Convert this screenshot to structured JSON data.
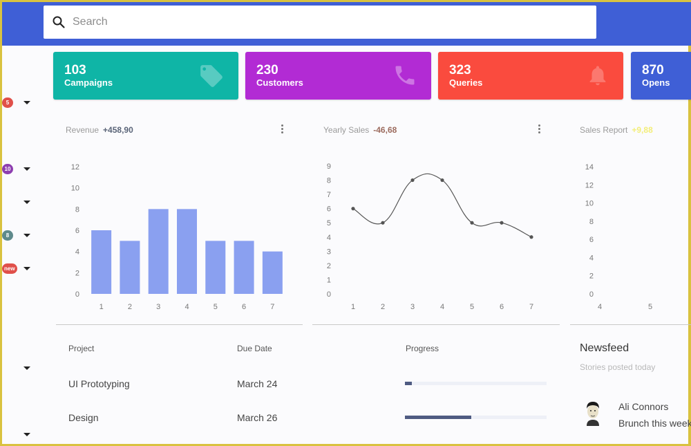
{
  "search": {
    "placeholder": "Search",
    "icon": "search-icon"
  },
  "sidebar": {
    "rows": [
      {
        "badge": "5",
        "badge_color": "#e0504a"
      },
      {
        "badge": "10",
        "badge_color": "#8e3fb0"
      },
      {
        "badge": null
      },
      {
        "badge": "8",
        "badge_color": "#5f8a8c"
      },
      {
        "badge": "new",
        "badge_color": "#e0504a"
      },
      {
        "badge": null
      },
      {
        "badge": null
      }
    ]
  },
  "stats": [
    {
      "value": "103",
      "label": "Campaigns",
      "icon": "tag-icon",
      "color": "#0fb5a6"
    },
    {
      "value": "230",
      "label": "Customers",
      "icon": "phone-icon",
      "color": "#b22bd4"
    },
    {
      "value": "323",
      "label": "Queries",
      "icon": "bell-icon",
      "color": "#fa4b3e"
    },
    {
      "value": "870",
      "label": "Opens",
      "icon": "",
      "color": "#3f5fd6"
    }
  ],
  "cards": {
    "revenue": {
      "label": "Revenue",
      "value": "+458,90",
      "value_color": "#5a6478"
    },
    "yearly": {
      "label": "Yearly Sales",
      "value": "-46,68",
      "value_color": "#9c6b5e"
    },
    "sales": {
      "label": "Sales Report",
      "value": "+9,88",
      "value_color": "#f3ee7a"
    }
  },
  "chart_data": [
    {
      "type": "bar",
      "title": "Revenue",
      "categories": [
        "1",
        "2",
        "3",
        "4",
        "5",
        "6",
        "7"
      ],
      "values": [
        6,
        5,
        8,
        8,
        5,
        5,
        4
      ],
      "ylim": [
        0,
        12
      ],
      "yticks": [
        0,
        2,
        4,
        6,
        8,
        10,
        12
      ],
      "color": "#8aa0f0",
      "grid": false
    },
    {
      "type": "line",
      "title": "Yearly Sales",
      "categories": [
        "1",
        "2",
        "3",
        "4",
        "5",
        "6",
        "7"
      ],
      "values": [
        6,
        5,
        8,
        8,
        5,
        5,
        4
      ],
      "ylim": [
        0,
        9
      ],
      "yticks": [
        0,
        1,
        2,
        3,
        4,
        5,
        6,
        7,
        8,
        9
      ],
      "color": "#555555",
      "grid": false
    },
    {
      "type": "bar",
      "title": "Sales Report",
      "categories": [
        "4",
        "5"
      ],
      "values": [],
      "ylim": [
        0,
        14
      ],
      "yticks": [
        0,
        2,
        4,
        6,
        8,
        10,
        12,
        14
      ],
      "grid": false
    }
  ],
  "table": {
    "headers": {
      "project": "Project",
      "due": "Due Date",
      "progress": "Progress"
    },
    "rows": [
      {
        "project": "UI Prototyping",
        "due": "March 24",
        "progress": 0.05
      },
      {
        "project": "Design",
        "due": "March 26",
        "progress": 0.47
      }
    ]
  },
  "newsfeed": {
    "title": "Newsfeed",
    "subtitle": "Stories posted today",
    "items": [
      {
        "name": "Ali Connors",
        "message": "Brunch this week"
      }
    ]
  }
}
